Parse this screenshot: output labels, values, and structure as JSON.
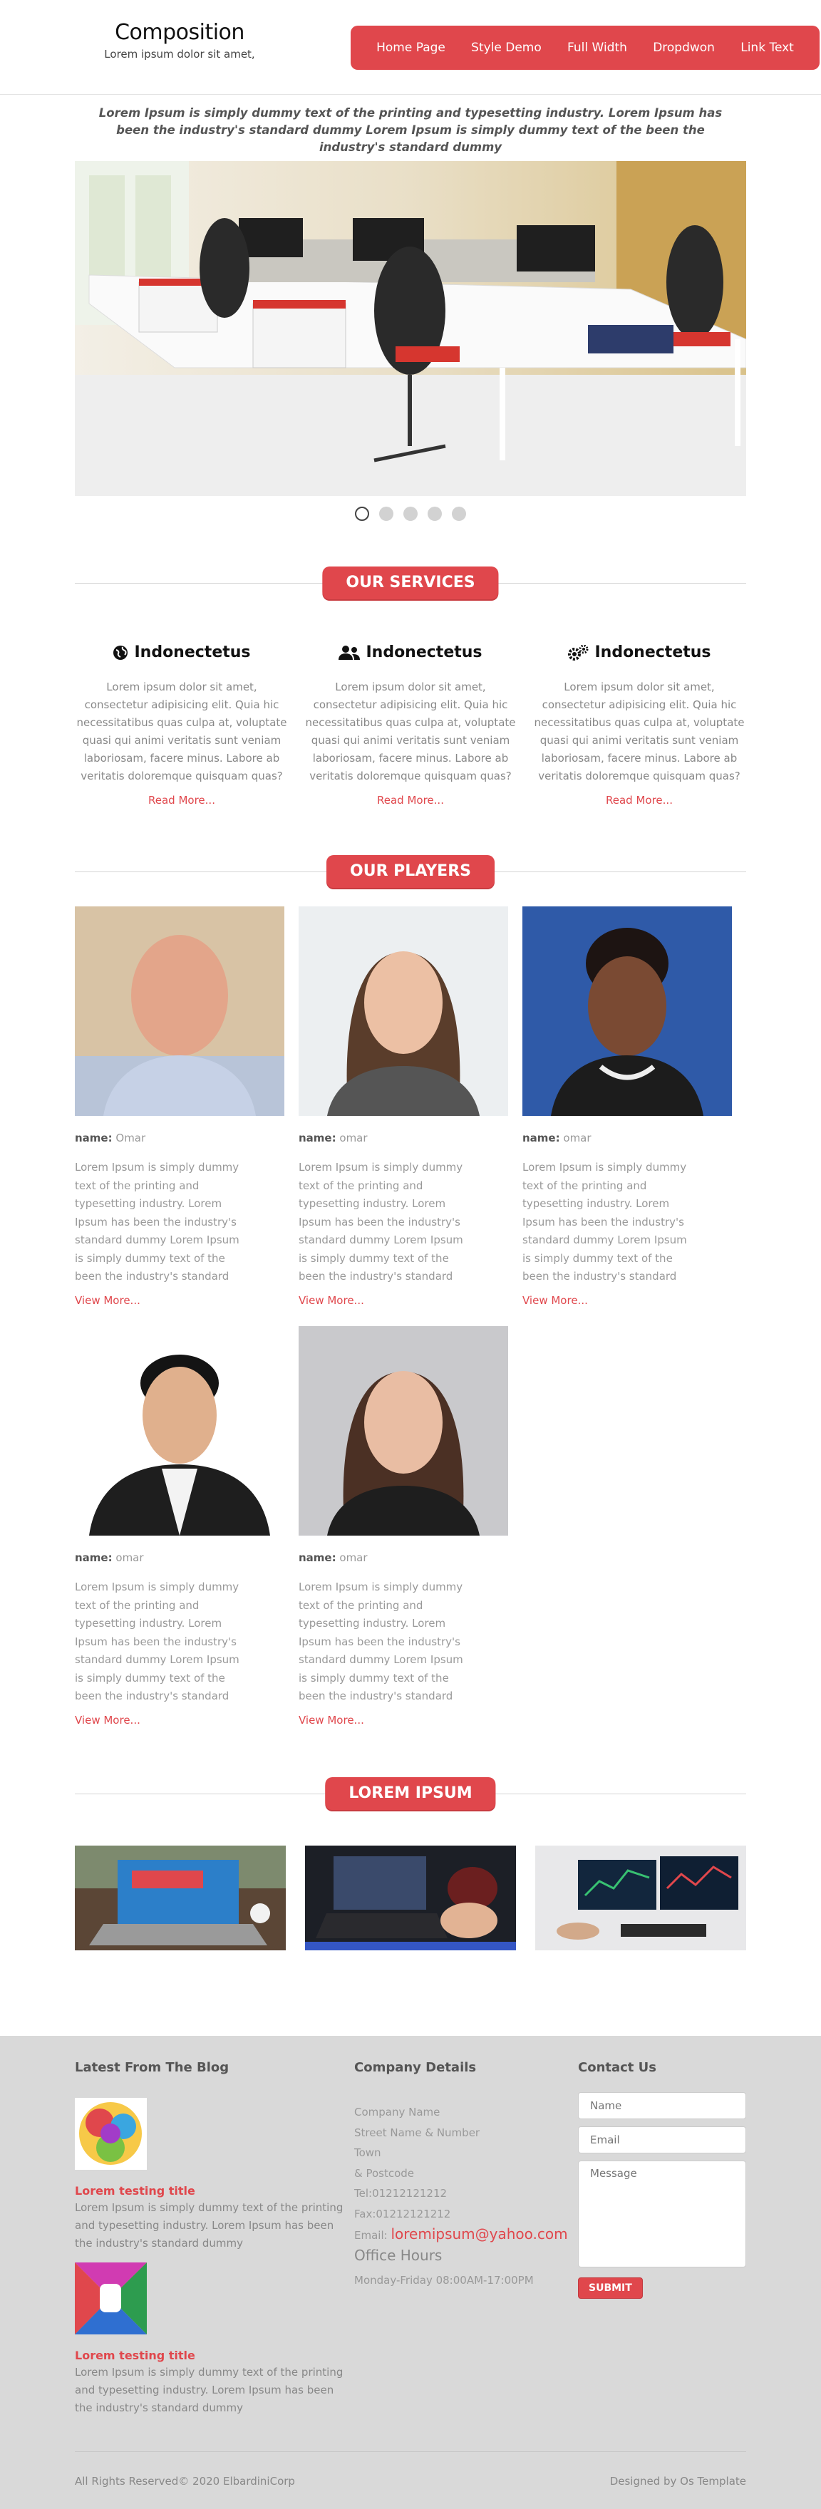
{
  "header": {
    "logo_title": "Composition",
    "logo_tagline": "Lorem ipsum dolor sit amet,",
    "nav": [
      "Home Page",
      "Style Demo",
      "Full Width",
      "Dropdwon",
      "Link Text"
    ]
  },
  "intro": "Lorem Ipsum is simply dummy text of the printing and typesetting industry. Lorem Ipsum has been the industry's standard dummy Lorem Ipsum is simply dummy text of the been the industry's standard dummy",
  "slider": {
    "active_slide": 1,
    "slide_count": 5
  },
  "services": {
    "heading": "OUR SERVICES",
    "items": [
      {
        "icon": "globe-icon",
        "title": "Indonectetus",
        "text": "Lorem ipsum dolor sit amet, consectetur adipisicing elit. Quia hic necessitatibus quas culpa at, voluptate quasi qui animi veritatis sunt veniam laboriosam, facere minus. Labore ab veritatis doloremque quisquam quas?",
        "link": "Read More..."
      },
      {
        "icon": "users-icon",
        "title": "Indonectetus",
        "text": "Lorem ipsum dolor sit amet, consectetur adipisicing elit. Quia hic necessitatibus quas culpa at, voluptate quasi qui animi veritatis sunt veniam laboriosam, facere minus. Labore ab veritatis doloremque quisquam quas?",
        "link": "Read More..."
      },
      {
        "icon": "gears-icon",
        "title": "Indonectetus",
        "text": "Lorem ipsum dolor sit amet, consectetur adipisicing elit. Quia hic necessitatibus quas culpa at, voluptate quasi qui animi veritatis sunt veniam laboriosam, facere minus. Labore ab veritatis doloremque quisquam quas?",
        "link": "Read More..."
      }
    ]
  },
  "players": {
    "heading": "OUR PLAYERS",
    "name_label": "name:",
    "items": [
      {
        "name": "Omar",
        "text": "Lorem Ipsum is simply dummy text of the printing and typesetting industry. Lorem Ipsum has been the industry's standard dummy Lorem Ipsum is simply dummy text of the been the industry's standard dummy",
        "link": "View More..."
      },
      {
        "name": "omar",
        "text": "Lorem Ipsum is simply dummy text of the printing and typesetting industry. Lorem Ipsum has been the industry's standard dummy Lorem Ipsum is simply dummy text of the been the industry's standard dummy",
        "link": "View More..."
      },
      {
        "name": "omar",
        "text": "Lorem Ipsum is simply dummy text of the printing and typesetting industry. Lorem Ipsum has been the industry's standard dummy Lorem Ipsum is simply dummy text of the been the industry's standard dummy",
        "link": "View More..."
      },
      {
        "name": "omar",
        "text": "Lorem Ipsum is simply dummy text of the printing and typesetting industry. Lorem Ipsum has been the industry's standard dummy Lorem Ipsum is simply dummy text of the been the industry's standard dummy",
        "link": "View More..."
      },
      {
        "name": "omar",
        "text": "Lorem Ipsum is simply dummy text of the printing and typesetting industry. Lorem Ipsum has been the industry's standard dummy Lorem Ipsum is simply dummy text of the been the industry's standard dummy",
        "link": "View More..."
      }
    ]
  },
  "gallery": {
    "heading": "LOREM IPSUM"
  },
  "footer": {
    "blog_title": "Latest From The Blog",
    "blog": [
      {
        "title": "Lorem testing title",
        "text": "Lorem Ipsum is simply dummy text of the printing and typesetting industry. Lorem Ipsum has been the industry's standard dummy"
      },
      {
        "title": "Lorem testing title",
        "text": "Lorem Ipsum is simply dummy text of the printing and typesetting industry. Lorem Ipsum has been the industry's standard dummy"
      }
    ],
    "company_title": "Company Details",
    "company_lines": [
      "Company Name",
      "Street Name & Number",
      "Town",
      "& Postcode",
      "Tel:01212121212",
      "Fax:01212121212"
    ],
    "email_label": "Email:",
    "email": "loremipsum@yahoo.com",
    "hours_title": "Office Hours",
    "hours": "Monday-Friday 08:00AM-17:00PM",
    "contact_title": "Contact Us",
    "contact_name_placeholder": "Name",
    "contact_email_placeholder": "Email",
    "contact_message_placeholder": "Message",
    "submit": "SUBMIT",
    "copyright": "All Rights Reserved© 2020 ElbardiniCorp",
    "designed": "Designed by Os Template"
  },
  "colors": {
    "accent": "#e0474c",
    "footer_bg": "#d9d9d9"
  }
}
